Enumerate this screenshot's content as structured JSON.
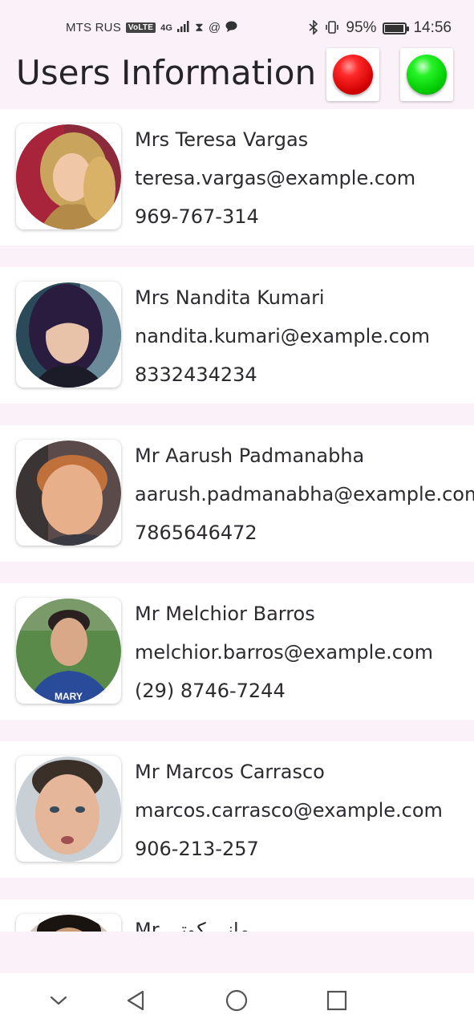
{
  "status_bar": {
    "carrier": "MTS RUS",
    "volte": "VoLTE",
    "network": "4G",
    "battery_percent": "95%",
    "battery_level": 0.95,
    "time": "14:56",
    "icons": [
      "signal-icon",
      "hourglass-icon",
      "at-icon",
      "chat-icon",
      "bluetooth-icon",
      "vibrate-icon",
      "battery-icon"
    ]
  },
  "header": {
    "title": "Users Information",
    "buttons": [
      {
        "name": "red-button",
        "color": "#e00000"
      },
      {
        "name": "green-button",
        "color": "#00d000"
      }
    ]
  },
  "users": [
    {
      "name": "Mrs Teresa Vargas",
      "email": "teresa.vargas@example.com",
      "phone": "969-767-314"
    },
    {
      "name": "Mrs Nandita Kumari",
      "email": "nandita.kumari@example.com",
      "phone": "8332434234"
    },
    {
      "name": "Mr Aarush Padmanabha",
      "email": "aarush.padmanabha@example.com",
      "phone": "7865646472"
    },
    {
      "name": "Mr Melchior Barros",
      "email": "melchior.barros@example.com",
      "phone": "(29) 8746-7244"
    },
    {
      "name": "Mr Marcos Carrasco",
      "email": "marcos.carrasco@example.com",
      "phone": "906-213-257"
    },
    {
      "name": "Mr ماني کوتی",
      "email": "",
      "phone": ""
    }
  ],
  "nav": {
    "icons": [
      "chevron-down-icon",
      "back-icon",
      "home-icon",
      "recents-icon"
    ]
  },
  "colors": {
    "background": "#faf2f8",
    "card": "#ffffff",
    "text": "#2d2a30"
  }
}
